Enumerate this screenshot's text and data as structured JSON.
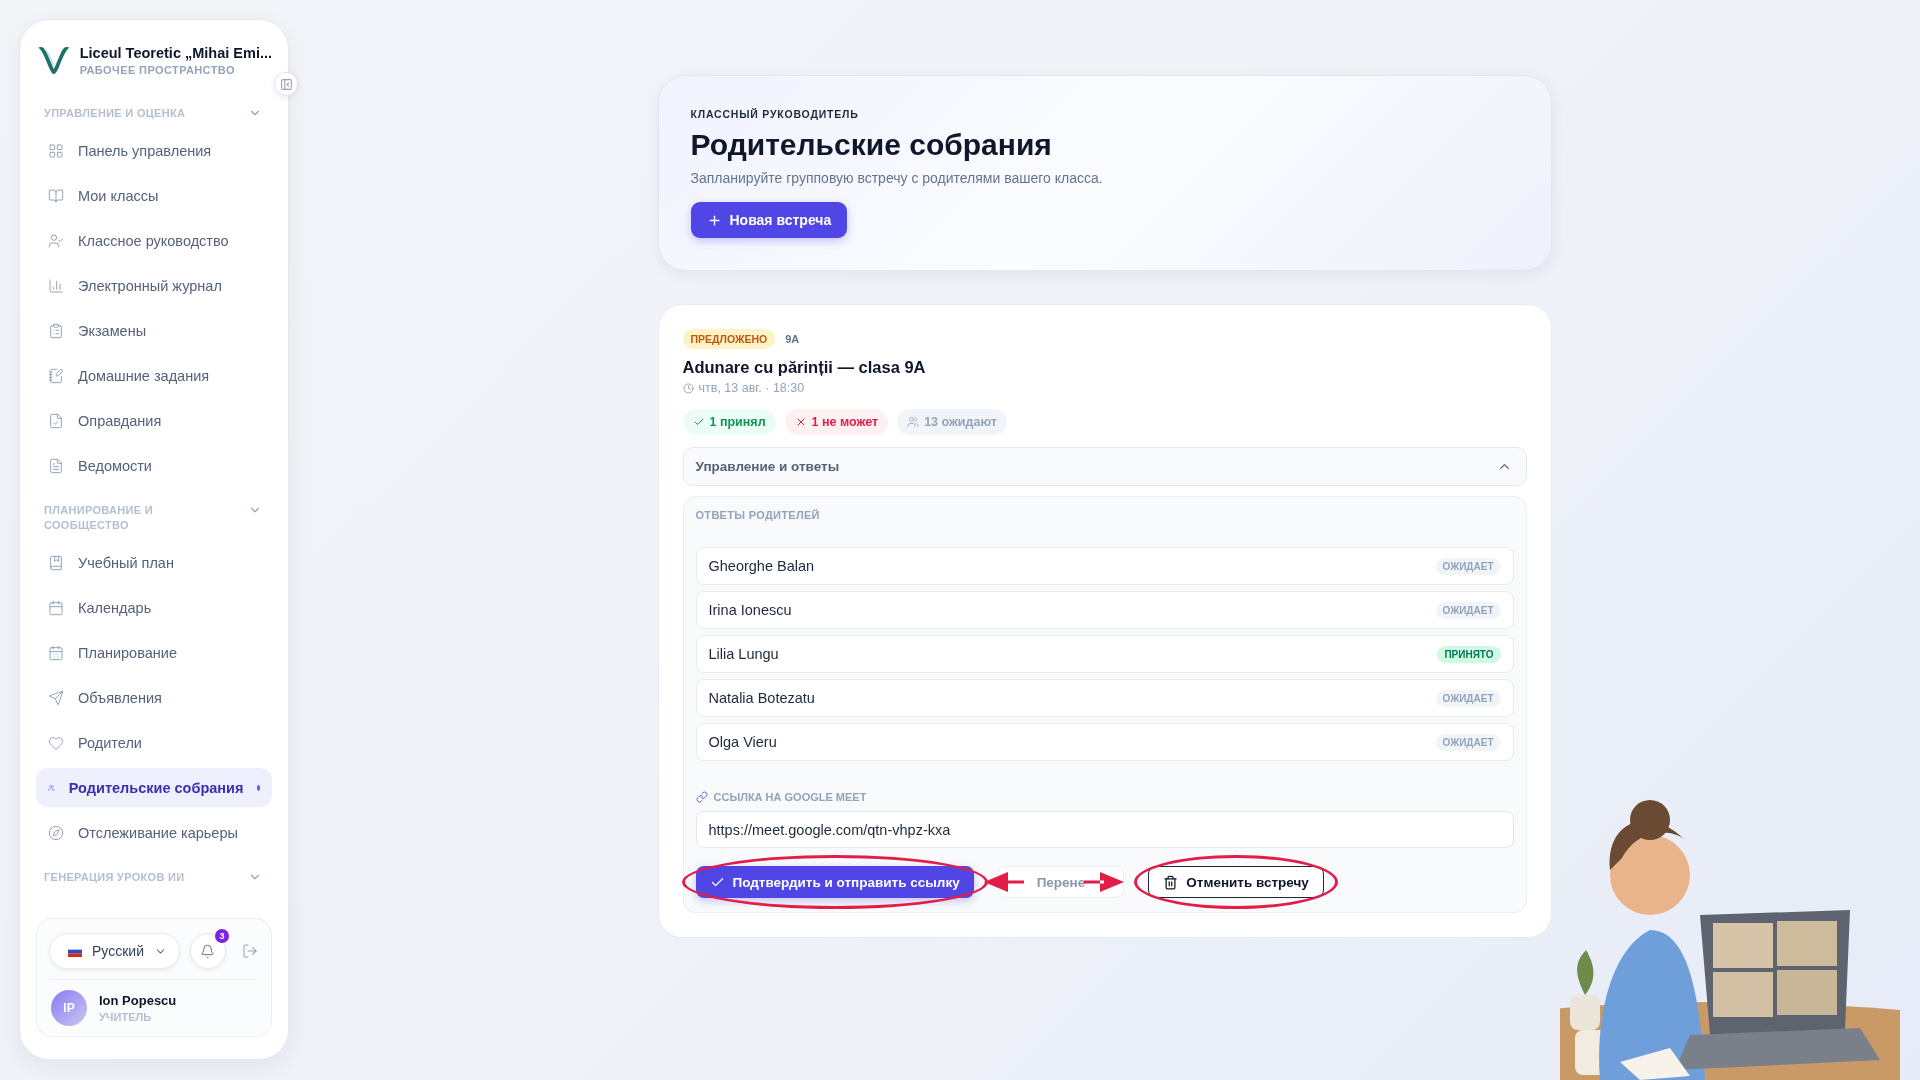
{
  "sidebar": {
    "brand": {
      "name": "Liceul Teoretic „Mihai Emi...",
      "subtitle": "РАБОЧЕЕ ПРОСТРАНСТВО"
    },
    "sections": [
      {
        "title": "УПРАВЛЕНИЕ И ОЦЕНКА",
        "items": [
          {
            "label": "Панель управления",
            "selected": false
          },
          {
            "label": "Мои классы",
            "selected": false
          },
          {
            "label": "Классное руководство",
            "selected": false
          },
          {
            "label": "Электронный журнал",
            "selected": false
          },
          {
            "label": "Экзамены",
            "selected": false
          },
          {
            "label": "Домашние задания",
            "selected": false
          },
          {
            "label": "Оправдания",
            "selected": false
          },
          {
            "label": "Ведомости",
            "selected": false
          }
        ]
      },
      {
        "title": "ПЛАНИРОВАНИЕ И СООБЩЕСТВО",
        "items": [
          {
            "label": "Учебный план",
            "selected": false
          },
          {
            "label": "Календарь",
            "selected": false
          },
          {
            "label": "Планирование",
            "selected": false
          },
          {
            "label": "Объявления",
            "selected": false
          },
          {
            "label": "Родители",
            "selected": false
          },
          {
            "label": "Родительские собрания",
            "selected": true
          },
          {
            "label": "Отслеживание карьеры",
            "selected": false
          }
        ]
      },
      {
        "title": "ГЕНЕРАЦИЯ УРОКОВ ИИ"
      }
    ],
    "language": "Русский",
    "notifications": "3",
    "user": {
      "initials": "IP",
      "name": "Ion Popescu",
      "role": "УЧИТЕЛЬ"
    }
  },
  "header": {
    "eyebrow": "КЛАССНЫЙ РУКОВОДИТЕЛЬ",
    "title": "Родительские собрания",
    "subtitle": "Запланируйте групповую встречу с родителями вашего класса.",
    "button": "Новая встреча"
  },
  "meeting": {
    "status": "ПРЕДЛОЖЕНО",
    "class": "9A",
    "title": "Adunare cu părinții — clasa 9A",
    "datetime": "чтв, 13 авг. · 18:30",
    "chips": [
      {
        "kind": "accepted",
        "label": "1 принял"
      },
      {
        "kind": "declined",
        "label": "1 не может"
      },
      {
        "kind": "pending",
        "label": "13 ожидают"
      }
    ],
    "accordion": {
      "title": "Управление и ответы",
      "expanded": true
    },
    "responses": {
      "title": "ОТВЕТЫ РОДИТЕЛЕЙ",
      "rows": [
        {
          "name": "Gheorghe Balan",
          "status": "ОЖИДАЕТ",
          "kind": "pending"
        },
        {
          "name": "Irina Ionescu",
          "status": "ОЖИДАЕТ",
          "kind": "pending"
        },
        {
          "name": "Lilia Lungu",
          "status": "ПРИНЯТО",
          "kind": "accepted"
        },
        {
          "name": "Natalia Botezatu",
          "status": "ОЖИДАЕТ",
          "kind": "pending"
        },
        {
          "name": "Olga Vieru",
          "status": "ОЖИДАЕТ",
          "kind": "pending"
        }
      ]
    },
    "link": {
      "label": "ССЫЛКА НА GOOGLE MEET",
      "value": "https://meet.google.com/qtn-vhpz-kxa"
    },
    "actions": [
      {
        "kind": "primary",
        "label": "Подтвердить и отправить ссылку",
        "circled": true
      },
      {
        "kind": "disabled",
        "label": "Перене",
        "circled": false
      },
      {
        "kind": "outline",
        "label": "Отменить встречу",
        "circled": true
      }
    ],
    "arrow_between_circled": true
  }
}
